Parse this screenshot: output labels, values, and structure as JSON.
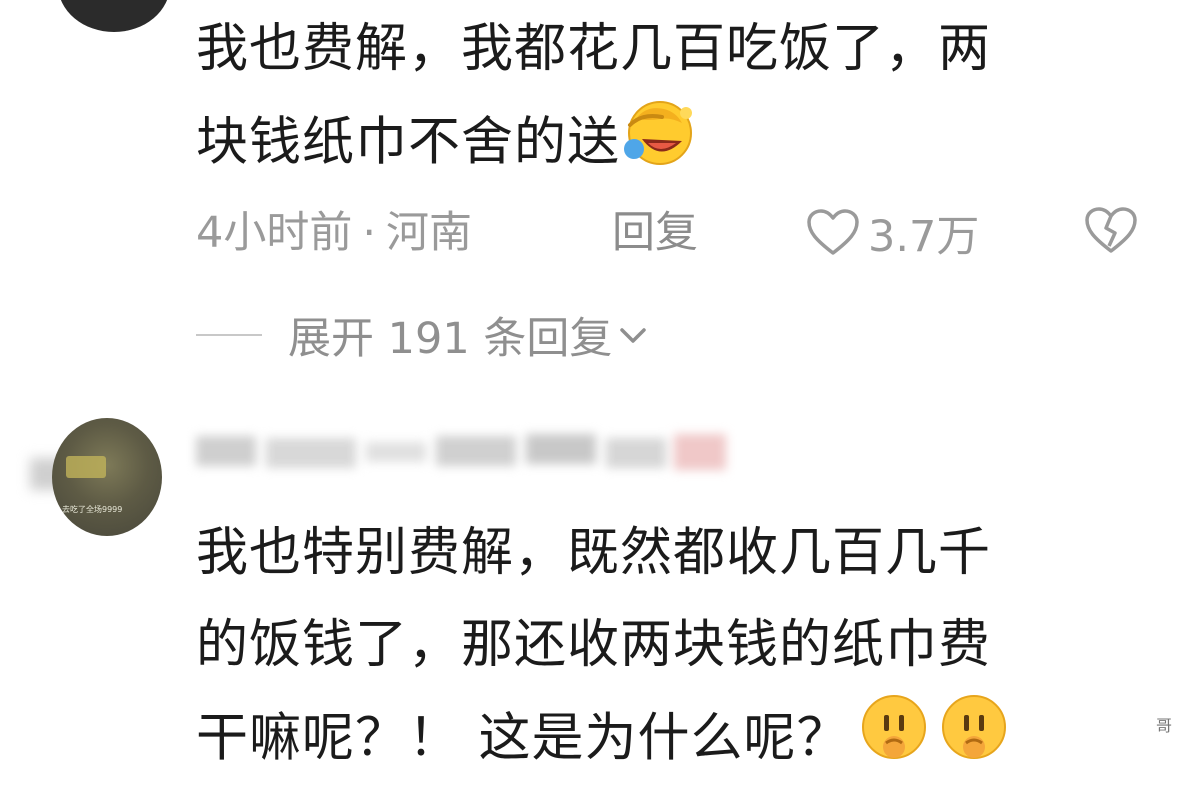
{
  "comment1": {
    "line1": "我也费解，我都花几百吃饭了，两",
    "line2": "块钱纸巾不舍的送",
    "emoji": "laughing-crying-emoji",
    "time": "4小时前",
    "dot": "·",
    "location": "河南",
    "reply_label": "回复",
    "like_count": "3.7万",
    "expand_label": "展开 191 条回复"
  },
  "comment2": {
    "avatar_tiny_text": "去吃了全场9999",
    "line1": "我也特别费解，既然都收几百几千",
    "line2": "的饭钱了，那还收两块钱的纸巾费",
    "line3": "干嘛呢？！ 这是为什么呢？",
    "emojis": [
      "confused-emoji",
      "confused-emoji"
    ],
    "side_char": "哥"
  }
}
